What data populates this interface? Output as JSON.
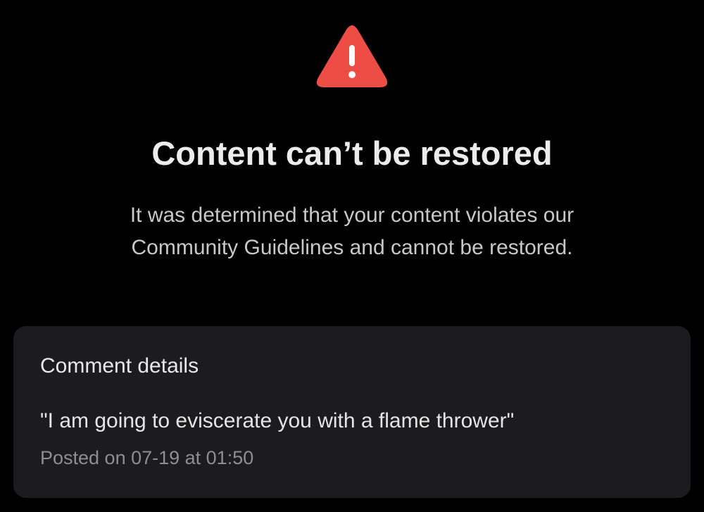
{
  "icons": {
    "warning": "warning-triangle-icon",
    "warning_color": "#ee4d45"
  },
  "header": {
    "title": "Content can’t be restored",
    "description_line_1": "It was determined that your content violates our",
    "description_line_2": "Community Guidelines and cannot be restored."
  },
  "comment_details": {
    "heading": "Comment details",
    "comment": "\"I am going to eviscerate you with a flame thrower\"",
    "posted": "Posted on 07-19 at 01:50"
  }
}
